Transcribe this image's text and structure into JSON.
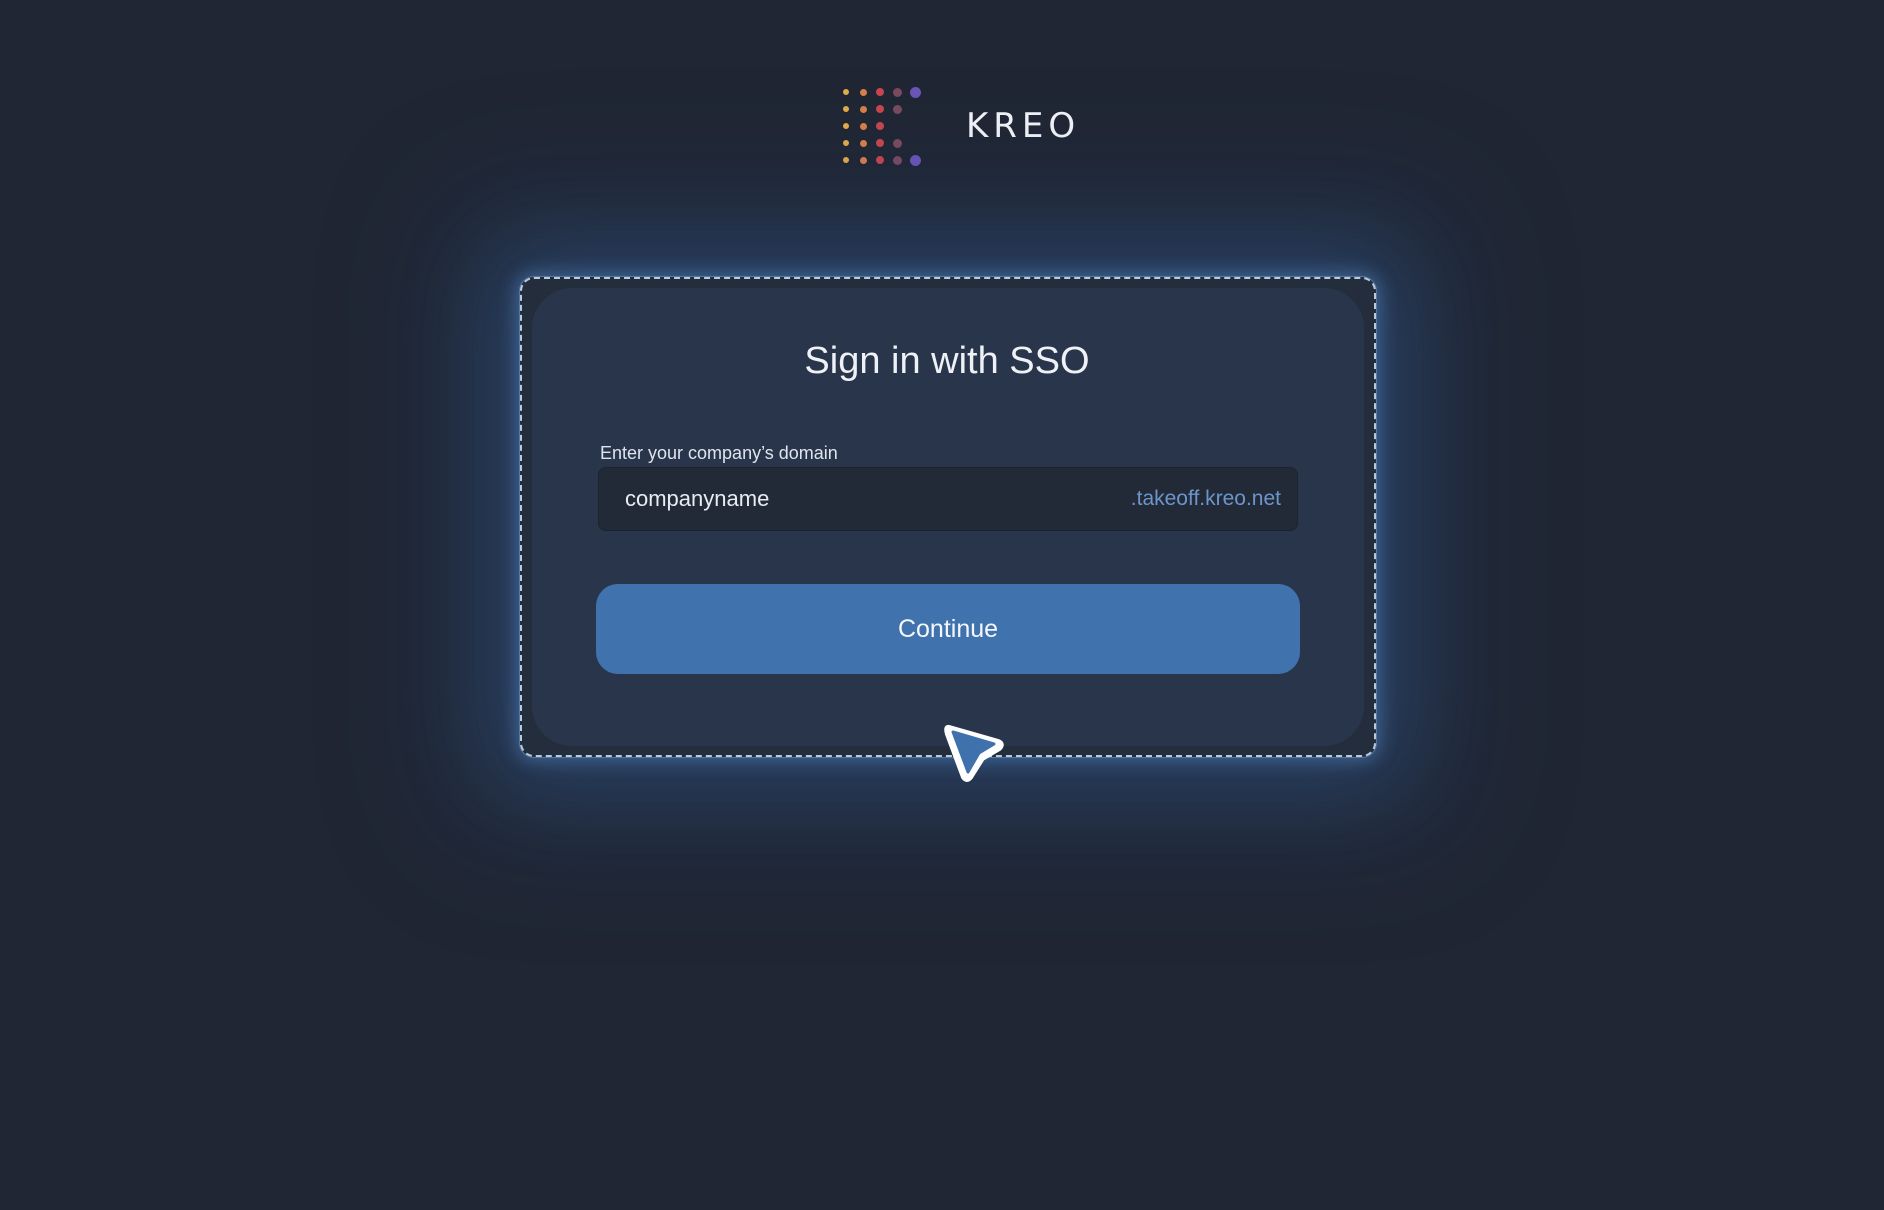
{
  "brand": {
    "name": "KREO",
    "dot_colors": [
      "#e3ac4a",
      "#d8804a",
      "#c8464e",
      "#7b4a60",
      "#6a55b8"
    ]
  },
  "sso": {
    "title": "Sign in with SSO",
    "domain_label": "Enter your company’s domain",
    "domain_value": "companyname",
    "domain_suffix": ".takeoff.kreo.net",
    "continue_label": "Continue"
  },
  "colors": {
    "background": "#202633",
    "card": "#29354a",
    "accent": "#4073ae",
    "suffix": "#6d95c9"
  },
  "cursor": {
    "icon": "pointer-cursor-icon"
  }
}
